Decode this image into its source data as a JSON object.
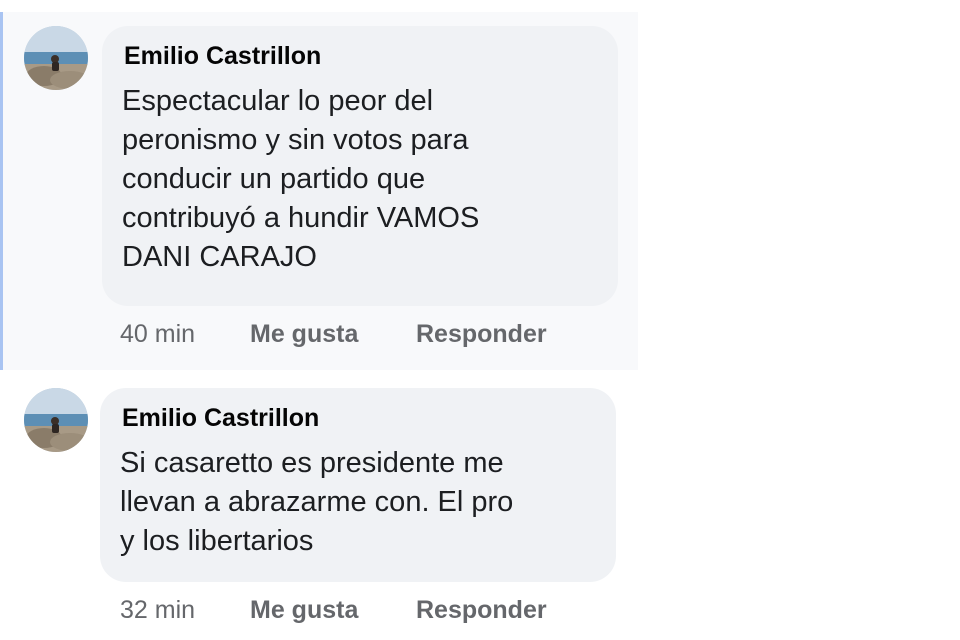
{
  "comments": [
    {
      "author": "Emilio Castrillon",
      "text": "Espectacular lo peor del\nperonismo y sin votos para\nconducir un partido que\ncontribuyó a hundir VAMOS\nDANI CARAJO",
      "time": "40 min",
      "like_label": "Me gusta",
      "reply_label": "Responder"
    },
    {
      "author": "Emilio Castrillon",
      "text": "Si casaretto es presidente me\nllevan a abrazarme con. El pro\ny los libertarios",
      "time": "32 min",
      "like_label": "Me gusta",
      "reply_label": "Responder"
    }
  ],
  "colors": {
    "bubble": "#f0f2f5",
    "thread_highlight": "#f8f9fb",
    "thread_line": "#a9c4f2",
    "meta_text": "#65676b"
  },
  "icons": [
    "avatar-photo"
  ]
}
